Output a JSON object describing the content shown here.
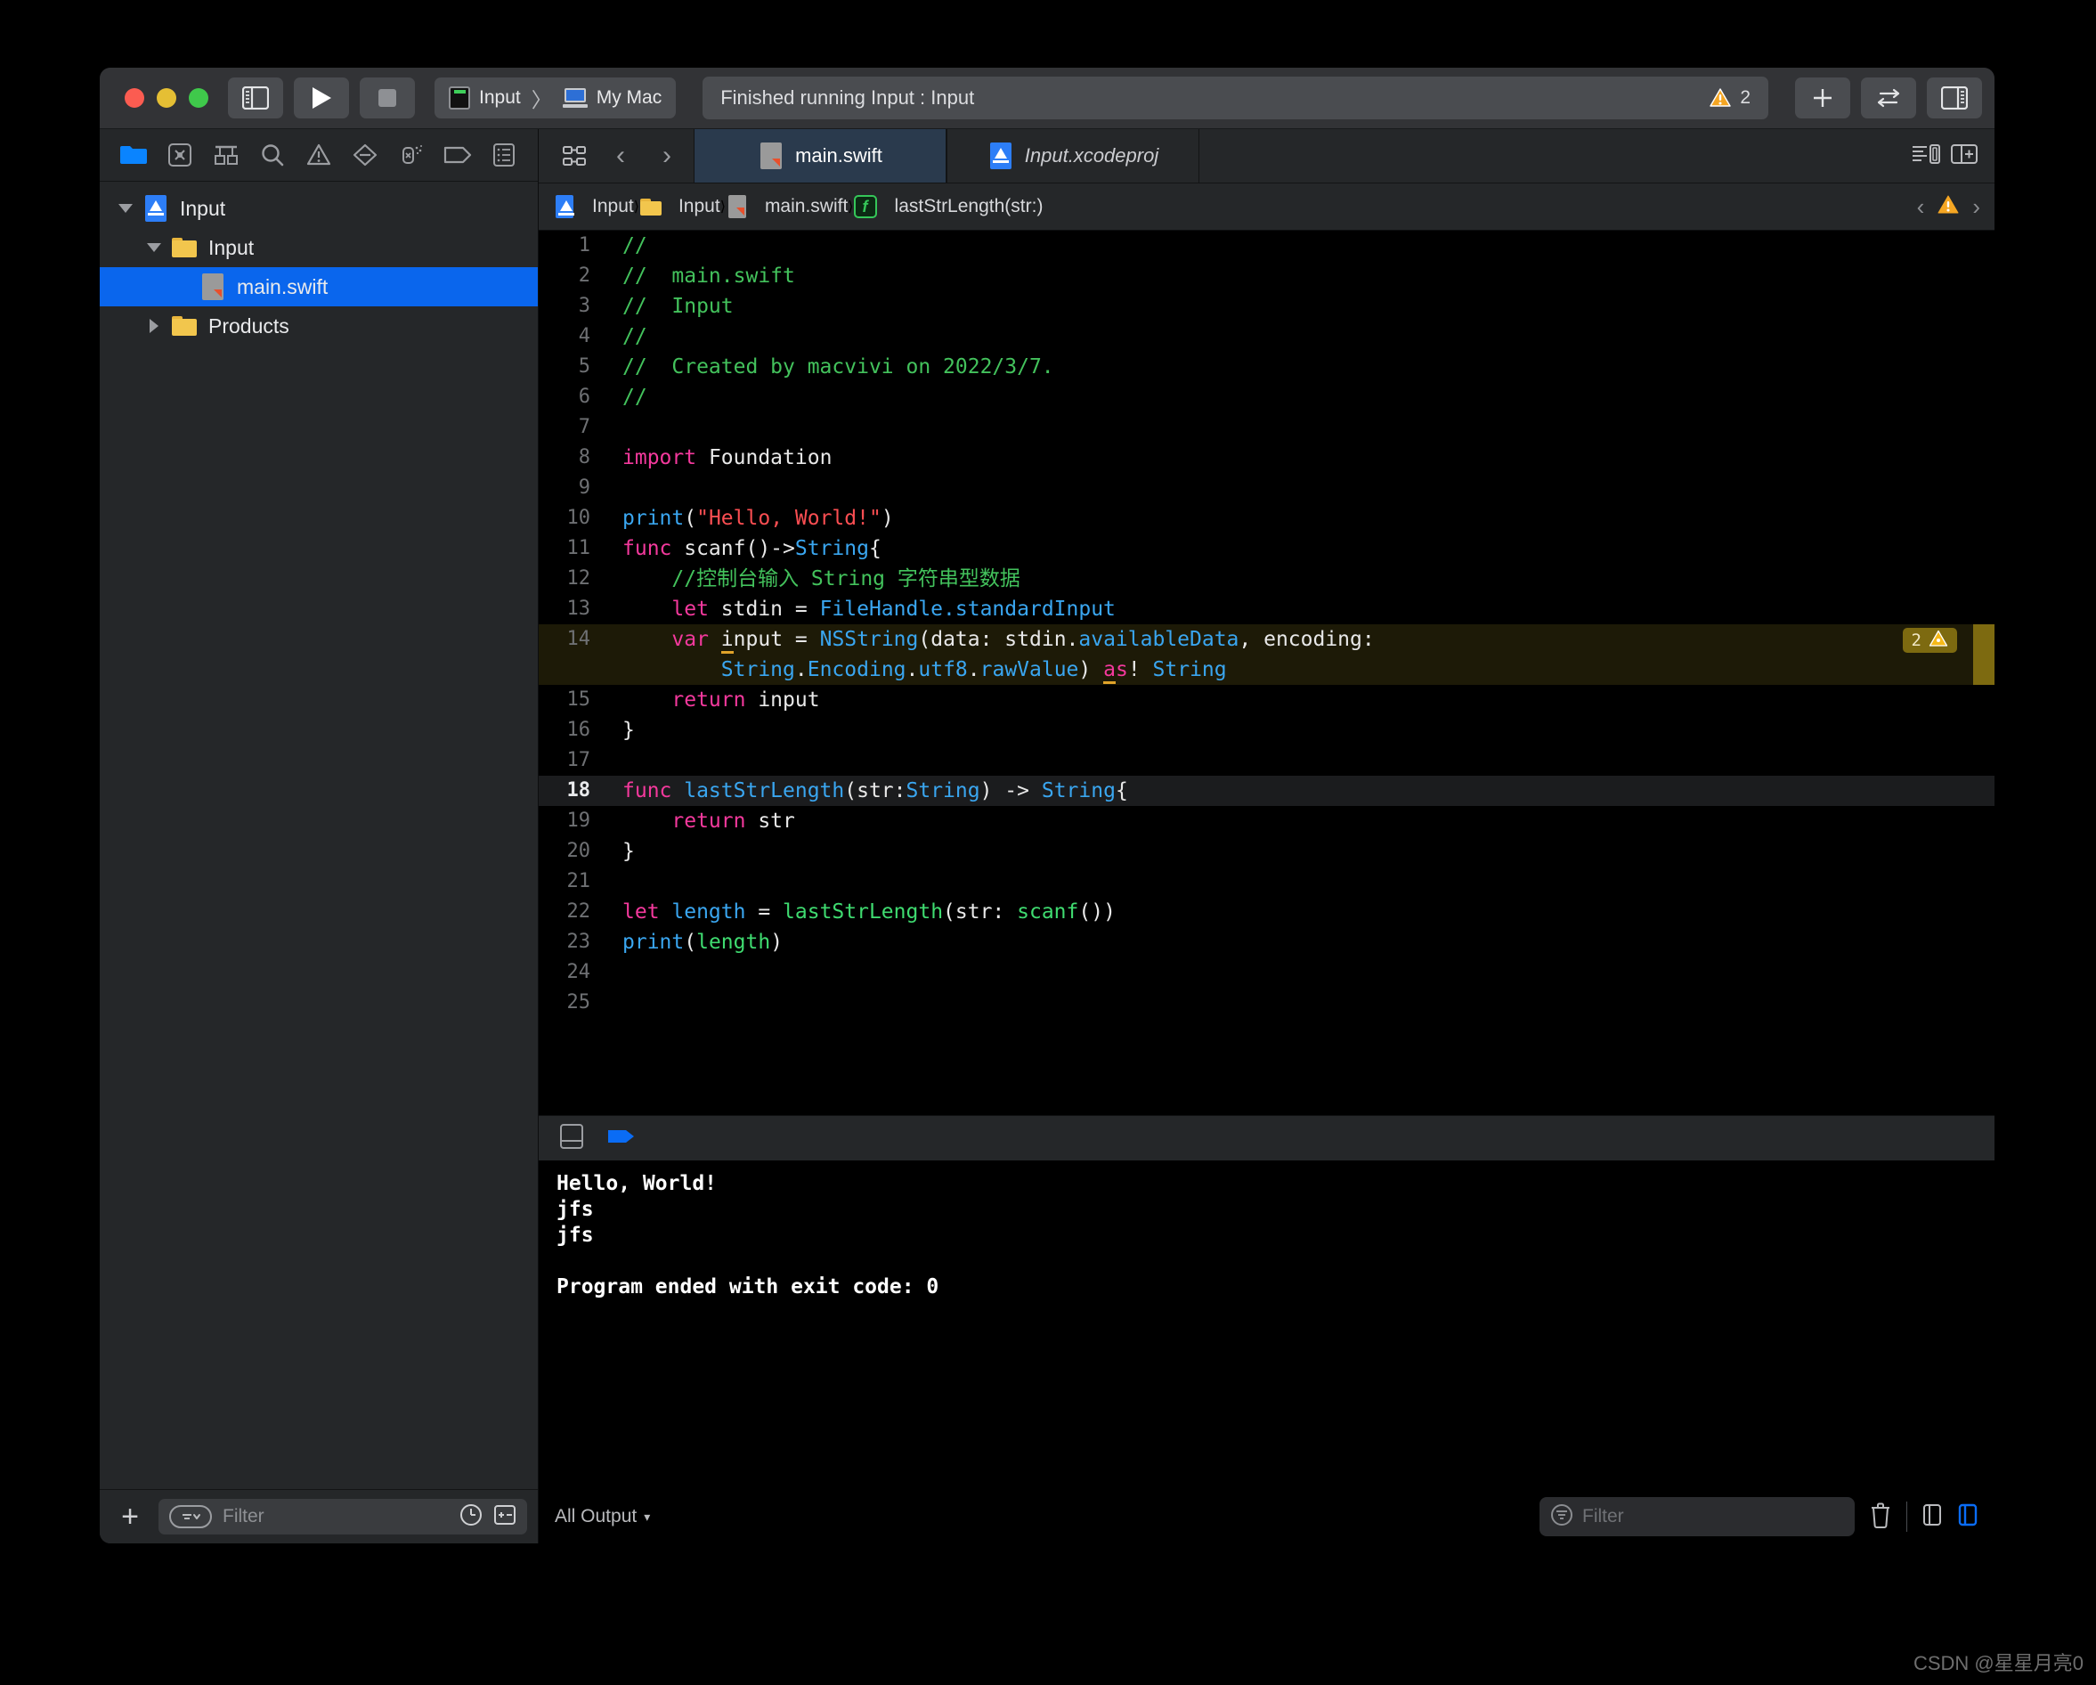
{
  "window": {
    "traffic_lights": [
      "close",
      "minimize",
      "zoom"
    ],
    "toolbar": {
      "sidebar_toggle": "sidebar-toggle",
      "run_label": "Run",
      "stop_label": "Stop",
      "scheme_name": "Input",
      "destination_name": "My Mac",
      "scheme_separator": "〉",
      "status_text": "Finished running Input : Input",
      "warning_count": "2",
      "add_label": "+",
      "swap_label": "swap-editor",
      "inspector_label": "inspector-toggle"
    }
  },
  "navigator": {
    "tabs": [
      {
        "name": "project-navigator-icon",
        "active": true
      },
      {
        "name": "source-control-navigator-icon",
        "active": false
      },
      {
        "name": "symbol-navigator-icon",
        "active": false
      },
      {
        "name": "find-navigator-icon",
        "active": false
      },
      {
        "name": "issue-navigator-icon",
        "active": false
      },
      {
        "name": "test-navigator-icon",
        "active": false
      },
      {
        "name": "debug-navigator-icon",
        "active": false
      },
      {
        "name": "breakpoint-navigator-icon",
        "active": false
      },
      {
        "name": "report-navigator-icon",
        "active": false
      }
    ],
    "tree": [
      {
        "label": "Input",
        "icon": "xcode-project-icon",
        "depth": 0,
        "twisty": "down",
        "selected": false
      },
      {
        "label": "Input",
        "icon": "folder-icon",
        "depth": 1,
        "twisty": "down",
        "selected": false
      },
      {
        "label": "main.swift",
        "icon": "swift-file-icon",
        "depth": 2,
        "twisty": "none",
        "selected": true
      },
      {
        "label": "Products",
        "icon": "folder-icon",
        "depth": 1,
        "twisty": "right",
        "selected": false
      }
    ],
    "bottom": {
      "add_label": "+",
      "filter_placeholder": "Filter",
      "recent_icon": "clock-icon",
      "sourcecontrol_icon": "diff-icon"
    }
  },
  "editor": {
    "tabs": [
      {
        "label": "main.swift",
        "icon": "swift-file-icon",
        "active": true,
        "italic": false
      },
      {
        "label": "Input.xcodeproj",
        "icon": "xcode-project-icon",
        "active": false,
        "italic": true
      }
    ],
    "nav_back": "‹",
    "nav_forward": "›",
    "breadcrumb": [
      {
        "label": "Input",
        "icon": "xcode-project-icon"
      },
      {
        "label": "Input",
        "icon": "folder-icon"
      },
      {
        "label": "main.swift",
        "icon": "swift-file-icon"
      },
      {
        "label": "lastStrLength(str:)",
        "icon": "function-icon"
      }
    ],
    "issue_prev": "‹",
    "issue_next": "›",
    "issue_icon": "warning-triangle-icon",
    "minimap_icon": "minimap-icon",
    "add_editor_icon": "add-editor-icon",
    "code": [
      {
        "num": "1",
        "state": "normal"
      },
      {
        "num": "2",
        "state": "normal"
      },
      {
        "num": "3",
        "state": "normal"
      },
      {
        "num": "4",
        "state": "normal"
      },
      {
        "num": "5",
        "state": "normal"
      },
      {
        "num": "6",
        "state": "normal"
      },
      {
        "num": "7",
        "state": "normal"
      },
      {
        "num": "8",
        "state": "normal"
      },
      {
        "num": "9",
        "state": "normal"
      },
      {
        "num": "10",
        "state": "normal"
      },
      {
        "num": "11",
        "state": "normal"
      },
      {
        "num": "12",
        "state": "normal"
      },
      {
        "num": "13",
        "state": "normal"
      },
      {
        "num": "14",
        "state": "warning"
      },
      {
        "num": "15",
        "state": "normal"
      },
      {
        "num": "16",
        "state": "normal"
      },
      {
        "num": "17",
        "state": "normal"
      },
      {
        "num": "18",
        "state": "current"
      },
      {
        "num": "19",
        "state": "normal"
      },
      {
        "num": "20",
        "state": "normal"
      },
      {
        "num": "21",
        "state": "normal"
      },
      {
        "num": "22",
        "state": "normal"
      },
      {
        "num": "23",
        "state": "normal"
      },
      {
        "num": "24",
        "state": "normal"
      },
      {
        "num": "25",
        "state": "normal"
      }
    ],
    "code_text": {
      "l1": "//",
      "l2": "//  main.swift",
      "l3": "//  Input",
      "l4": "//",
      "l5": "//  Created by macvivi on 2022/3/7.",
      "l6": "//",
      "l8_kw": "import",
      "l8_mod": " Foundation",
      "l10_fn": "print",
      "l10_str": "\"Hello, World!\"",
      "l11_kw": "func",
      "l11_name": " scanf()->",
      "l11_type": "String",
      "l11_brace": "{",
      "l12_cmt": "    //控制台输入 String 字符串型数据",
      "l13_kw": "    let",
      "l13_id": " stdin = ",
      "l13_type": "FileHandle",
      "l13_mem": ".standardInput",
      "l14_kw": "    var",
      "l14_a": "i",
      "l14_b": "nput = ",
      "l14_type": "NSString",
      "l14_c": "(data: stdin.",
      "l14_mem": "availableData",
      "l14_d": ", encoding:",
      "l14b_type1": "        String",
      "l14b_dot1": ".",
      "l14b_type2": "Encoding",
      "l14b_dot2": ".",
      "l14b_mem1": "utf8",
      "l14b_dot3": ".",
      "l14b_mem2": "rawValue",
      "l14b_paren": ") ",
      "l14b_as_a": "a",
      "l14b_as_b": "s",
      "l14b_bang": "! ",
      "l14b_type3": "String",
      "l15_kw": "    return",
      "l15_id": " input",
      "l16": "}",
      "l18_kw": "func",
      "l18_name": " lastStrLength",
      "l18_p1": "(str:",
      "l18_t1": "String",
      "l18_p2": ") -> ",
      "l18_t2": "String",
      "l18_brace": "{",
      "l19_kw": "    return",
      "l19_id": " str",
      "l20": "}",
      "l22_kw": "let",
      "l22_id": " length",
      "l22_eq": " = ",
      "l22_fn": "lastStrLength",
      "l22_args": "(str: ",
      "l22_fn2": "scanf",
      "l22_tail": "())",
      "l23_fn": "print",
      "l23_p1": "(",
      "l23_arg": "length",
      "l23_p2": ")"
    },
    "line14_badge_count": "2"
  },
  "console": {
    "toolbar": {
      "panel_icon": "console-split-icon",
      "flag_icon": "blue-flag-icon"
    },
    "output_lines": [
      "Hello, World!",
      "jfs",
      "jfs",
      "",
      "Program ended with exit code: 0"
    ],
    "bottom": {
      "scope_label": "All Output",
      "filter_placeholder": "Filter",
      "trash_icon": "trash-icon",
      "variables_pane_icon": "variables-pane-icon",
      "console-pane-icon": "console-pane-icon"
    }
  },
  "watermark": "CSDN @星星月亮0",
  "colors": {
    "accent_blue": "#0a66ed",
    "warning_yellow": "#f5a623",
    "comment_green": "#43c25c",
    "keyword_pink": "#f4399d",
    "string_red": "#fb4e52",
    "type_blue": "#3aa6f0",
    "symbol_green": "#3fdb70",
    "titlebar": "#323336",
    "navigator_bg": "#252729",
    "editor_bg": "#000000"
  }
}
